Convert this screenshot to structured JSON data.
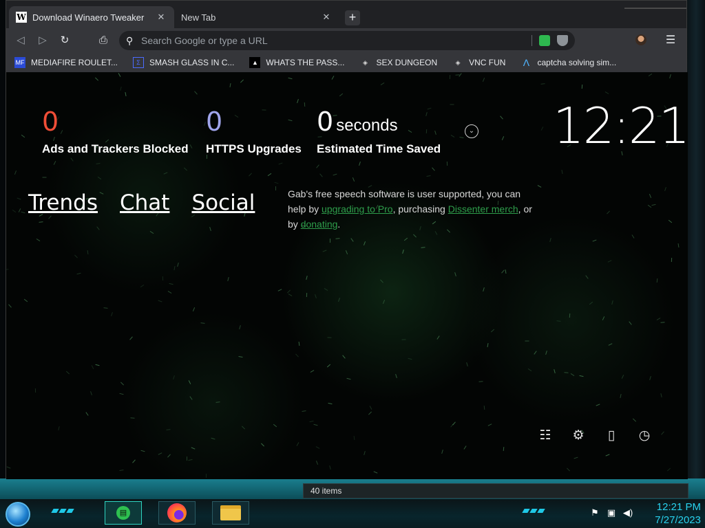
{
  "browser": {
    "tabs": [
      {
        "label": "Download Winaero Tweaker",
        "favicon": "W",
        "active": true
      },
      {
        "label": "New Tab",
        "active": false
      }
    ],
    "omnibox": {
      "placeholder": "Search Google or type a URL"
    },
    "bookmarks": [
      {
        "label": "MEDIAFIRE ROULET...",
        "icon": "mediafire-icon"
      },
      {
        "label": "SMASH GLASS IN C...",
        "icon": "bookmark-icon"
      },
      {
        "label": "WHATS THE PASS...",
        "icon": "bookmark-icon"
      },
      {
        "label": "SEX DUNGEON",
        "icon": "bookmark-icon"
      },
      {
        "label": "VNC FUN",
        "icon": "bookmark-icon"
      },
      {
        "label": "captcha solving sim...",
        "icon": "bookmark-icon"
      }
    ]
  },
  "newtab": {
    "stats": [
      {
        "value": "0",
        "unit": "",
        "label": "Ads and Trackers Blocked",
        "color": "#f04e37"
      },
      {
        "value": "0",
        "unit": "",
        "label": "HTTPS Upgrades",
        "color": "#a0a5eb"
      },
      {
        "value": "0",
        "unit": "seconds",
        "label": "Estimated Time Saved",
        "color": "#ffffff"
      }
    ],
    "clock": "12:21",
    "links": [
      "Trends",
      "Chat",
      "Social"
    ],
    "promo": {
      "text1": "Gab's free speech software is user supported, you can help by ",
      "link1": "upgrading to Pro",
      "text2": ", purchasing ",
      "link2": "Dissenter merch",
      "text3": ", or by ",
      "link3": "donating",
      "text4": "."
    },
    "bottom_icons": [
      "settings-sliders-icon",
      "gear-icon",
      "bookmarks-icon",
      "history-icon"
    ]
  },
  "explorer": {
    "status": "40 items"
  },
  "taskbar": {
    "time": "12:21 PM",
    "date": "7/27/2023"
  }
}
